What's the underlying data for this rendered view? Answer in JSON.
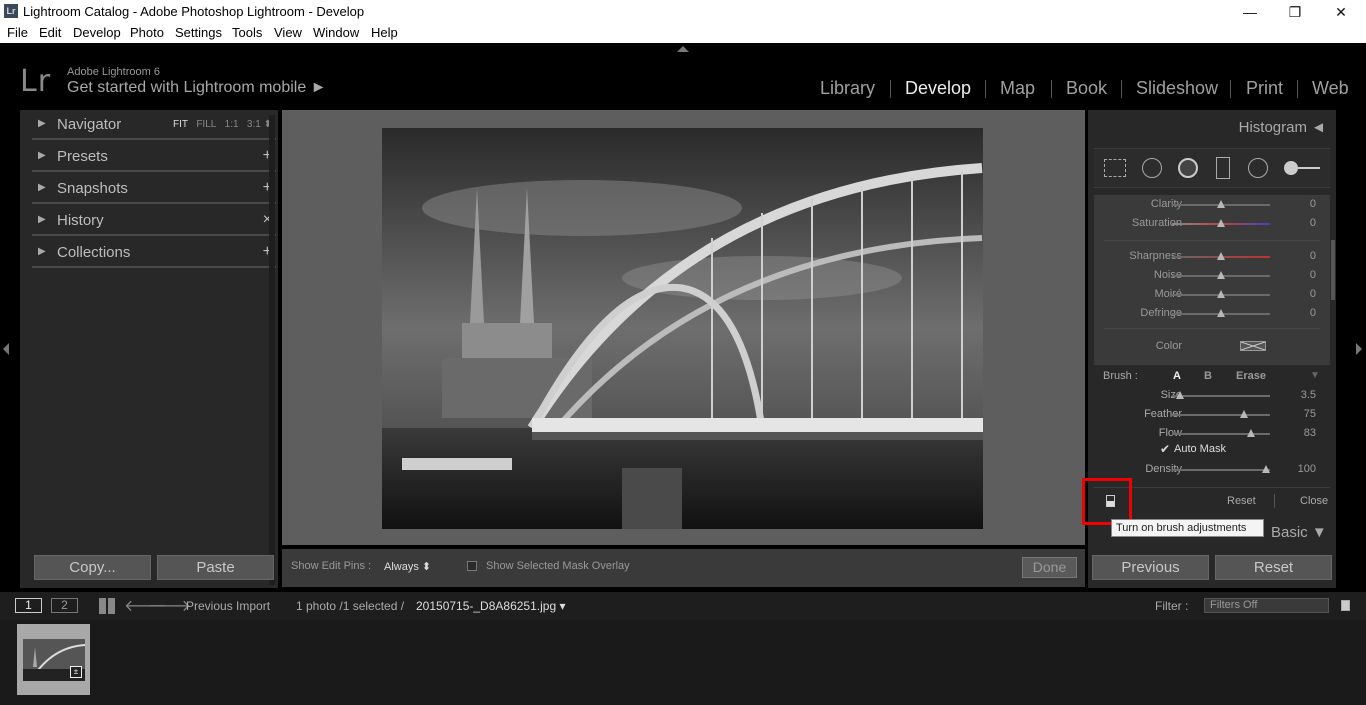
{
  "window": {
    "title": "Lightroom Catalog - Adobe Photoshop Lightroom - Develop",
    "app_icon": "Lr"
  },
  "menu": [
    "File",
    "Edit",
    "Develop",
    "Photo",
    "Settings",
    "Tools",
    "View",
    "Window",
    "Help"
  ],
  "identity": {
    "logo": "Lr",
    "product": "Adobe Lightroom 6",
    "tagline": "Get started with Lightroom mobile ►"
  },
  "modules": [
    "Library",
    "Develop",
    "Map",
    "Book",
    "Slideshow",
    "Print",
    "Web"
  ],
  "left_panel": {
    "navigator": {
      "label": "Navigator",
      "options": [
        "FIT",
        "FILL",
        "1:1",
        "3:1"
      ]
    },
    "presets": {
      "label": "Presets",
      "action": "+"
    },
    "snapshots": {
      "label": "Snapshots",
      "action": "+"
    },
    "history": {
      "label": "History",
      "action": "×"
    },
    "collections": {
      "label": "Collections",
      "action": "+"
    },
    "copy_label": "Copy...",
    "paste_label": "Paste"
  },
  "toolbar": {
    "pins_label": "Show Edit Pins :",
    "pins_value": "Always ⬍",
    "overlay_label": "Show Selected Mask Overlay",
    "done_label": "Done"
  },
  "right_panel": {
    "histogram_label": "Histogram ◄",
    "sliders": [
      {
        "label": "Clarity",
        "value": "0",
        "pos": 0.5
      },
      {
        "label": "Saturation",
        "value": "0",
        "pos": 0.5
      },
      {
        "label": "Sharpness",
        "value": "0",
        "pos": 0.5
      },
      {
        "label": "Noise",
        "value": "0",
        "pos": 0.5
      },
      {
        "label": "Moiré",
        "value": "0",
        "pos": 0.5
      },
      {
        "label": "Defringe",
        "value": "0",
        "pos": 0.5
      }
    ],
    "color_label": "Color",
    "brush": {
      "label": "Brush :",
      "a": "A",
      "b": "B",
      "erase": "Erase",
      "size": {
        "label": "Size",
        "value": "3.5",
        "pos": 0.08
      },
      "feather": {
        "label": "Feather",
        "value": "75",
        "pos": 0.75
      },
      "flow": {
        "label": "Flow",
        "value": "83",
        "pos": 0.83
      },
      "automask": "Auto Mask",
      "density": {
        "label": "Density",
        "value": "100",
        "pos": 1.0
      }
    },
    "reset_label": "Reset",
    "close_label": "Close",
    "tooltip": "Turn on brush adjustments",
    "basic_label": "Basic ▼",
    "previous_label": "Previous",
    "reset_big_label": "Reset"
  },
  "filmstrip": {
    "page1": "1",
    "page2": "2",
    "source": "Previous Import",
    "count": "1 photo /1 selected /",
    "filename": "20150715-_D8A86251.jpg ▾",
    "filter_label": "Filter :",
    "filter_value": "Filters Off"
  }
}
